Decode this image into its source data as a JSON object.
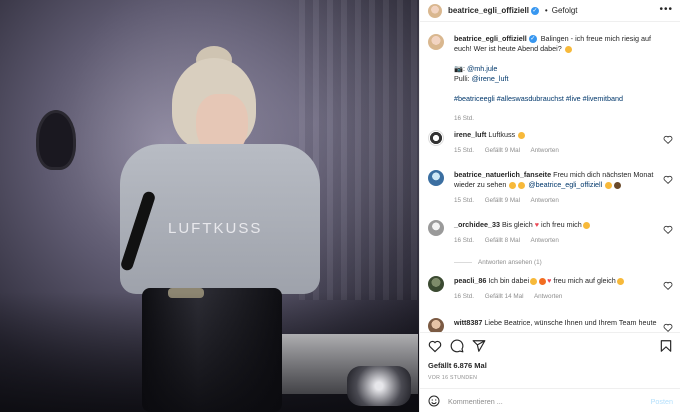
{
  "post": {
    "username": "beatrice_egli_offiziell",
    "separator": "•",
    "follow_label": "Gefolgt",
    "more_label": "•••"
  },
  "photo": {
    "hoodie_print": "LUFTKUSS"
  },
  "caption": {
    "username": "beatrice_egli_offiziell",
    "text": "Balingen - ich freue mich riesig auf euch! Wer ist heute Abend dabei?",
    "camera_prefix": "📷:",
    "camera_tag": "@mh.jule",
    "pulli_prefix": "Pulli:",
    "pulli_tag": "@irene_luft",
    "hashtags": "#beatriceegli #alleswasdubrauchst #live #livemitband",
    "time": "16 Std."
  },
  "comments": [
    {
      "username": "irene_luft",
      "text": "Luftkuss",
      "time": "15 Std.",
      "likes": "Gefällt 9 Mal",
      "reply": "Antworten"
    },
    {
      "username": "beatrice_natuerlich_fanseite",
      "text": "Freu mich dich nächsten Monat wieder zu sehen",
      "mention": "@beatrice_egli_offiziell",
      "time": "15 Std.",
      "likes": "Gefällt 9 Mal",
      "reply": "Antworten"
    },
    {
      "username": "_orchidee_33",
      "text_before": "Bis gleich",
      "text_after": "ich freu mich",
      "time": "16 Std.",
      "likes": "Gefällt 8 Mal",
      "reply": "Antworten"
    },
    {
      "username": "peacli_86",
      "text_before": "Ich bin dabei",
      "text_after": "freu mich auf gleich",
      "time": "16 Std.",
      "likes": "Gefällt 14 Mal",
      "reply": "Antworten"
    },
    {
      "username": "witt8387",
      "text": "Liebe Beatrice, wünsche Ihnen und Ihrem Team heute"
    }
  ],
  "view_replies": "Antworten ansehen (1)",
  "footer": {
    "likes": "Gefällt 6.876 Mal",
    "time_ago": "VOR 16 STUNDEN",
    "comment_placeholder": "Kommentieren ...",
    "post_label": "Posten"
  },
  "colors": {
    "verified": "#3897f0",
    "link": "#00376b",
    "muted": "#8e8e8e",
    "post_button_disabled": "#b2dffc",
    "heart_red": "#ed4956"
  },
  "icons": {
    "like": "heart-icon",
    "comment": "comment-icon",
    "share": "paper-plane-icon",
    "save": "bookmark-icon",
    "emoji": "smiley-icon",
    "verified": "verified-badge-icon",
    "more": "more-options-icon"
  }
}
